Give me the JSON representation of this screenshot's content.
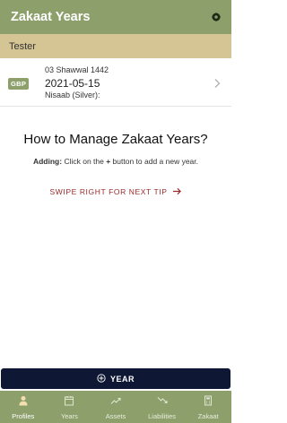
{
  "app": {
    "title": "Zakaat Years"
  },
  "profile": {
    "name": "Tester"
  },
  "year_entry": {
    "currency": "GBP",
    "hijri_date": "03 Shawwal 1442",
    "gregorian_date": "2021-05-15",
    "nisaab_label": "Nisaab (Silver):"
  },
  "tip": {
    "heading": "How to Manage Zakaat Years?",
    "adding_label": "Adding:",
    "adding_text_before": " Click on the ",
    "adding_plus": "+",
    "adding_text_after": " button to add a new year.",
    "swipe_label": "SWIPE RIGHT FOR NEXT TIP"
  },
  "add_year_button": {
    "label": "YEAR"
  },
  "nav": {
    "items": [
      {
        "label": "Profiles",
        "icon": "person-icon"
      },
      {
        "label": "Years",
        "icon": "calendar-icon"
      },
      {
        "label": "Assets",
        "icon": "trending-up-icon"
      },
      {
        "label": "Liabilities",
        "icon": "trending-down-icon"
      },
      {
        "label": "Zakaat",
        "icon": "calculator-icon"
      }
    ]
  },
  "colors": {
    "primary": "#8da06c",
    "profile_bar": "#d6c594",
    "button_dark": "#0e1733",
    "swipe_text": "#9b2a2a"
  }
}
